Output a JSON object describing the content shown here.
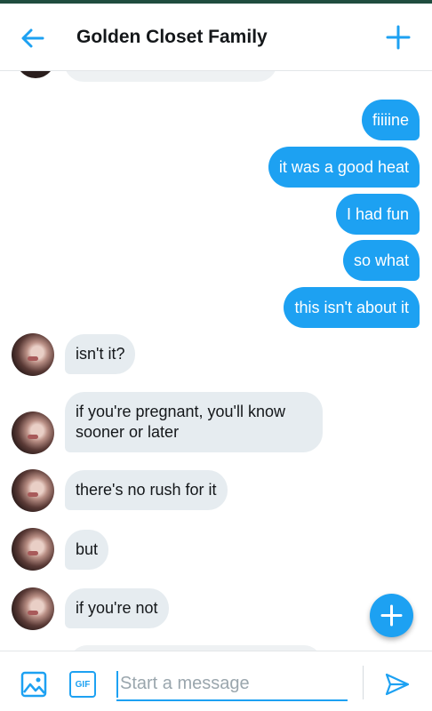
{
  "header": {
    "title": "Golden Closet Family",
    "back_icon": "arrow-left-icon",
    "action_icon": "plus-icon"
  },
  "messages": [
    {
      "side": "out",
      "text": "fiiiine"
    },
    {
      "side": "out",
      "text": "it was a good heat"
    },
    {
      "side": "out",
      "text": "I had fun"
    },
    {
      "side": "out",
      "text": "so what"
    },
    {
      "side": "out",
      "text": "this isn't about it"
    },
    {
      "side": "in",
      "text": "isn't it?"
    },
    {
      "side": "in",
      "text": "if you're pregnant, you'll know sooner or later"
    },
    {
      "side": "in",
      "text": "there's no rush for it"
    },
    {
      "side": "in",
      "text": "but"
    },
    {
      "side": "in",
      "text": "if you're not"
    }
  ],
  "composer": {
    "placeholder": "Start a message",
    "image_icon": "image-icon",
    "gif_label": "GIF",
    "send_icon": "send-icon"
  },
  "fab_icon": "plus-icon",
  "colors": {
    "accent": "#1da1f2",
    "incoming_bubble": "#e6ecf0",
    "top_bar": "#1f4d3f"
  }
}
